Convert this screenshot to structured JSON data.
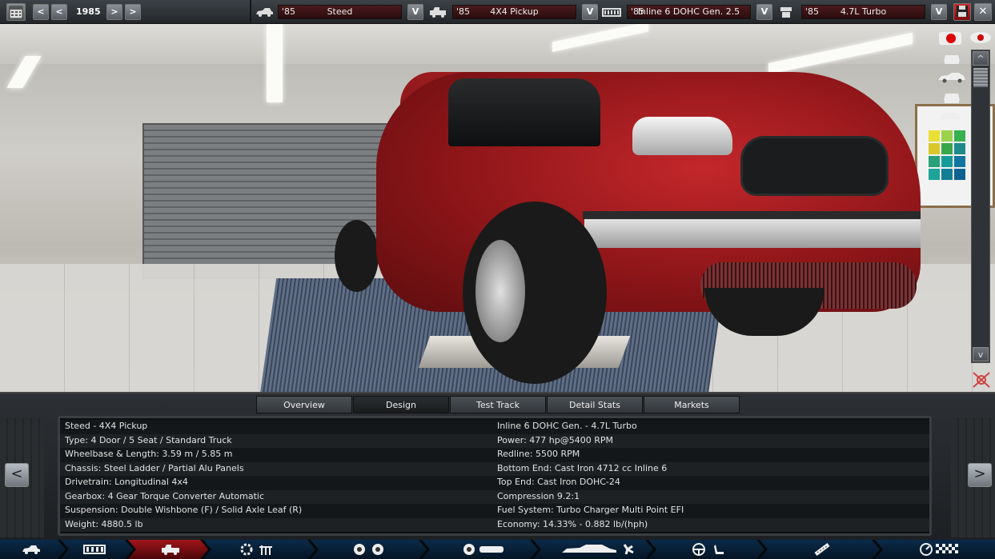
{
  "topbar": {
    "year": "1985",
    "car_model": {
      "year": "'85",
      "name": "Steed"
    },
    "trim": {
      "year": "'85",
      "name": "4X4 Pickup"
    },
    "engine_family": {
      "year": "'85",
      "name": "Inline 6 DOHC Gen. 2.5"
    },
    "engine_variant": {
      "year": "'85",
      "name": "4.7L Turbo"
    },
    "dropdown_glyph": "V",
    "prev_label": "<",
    "next_label": ">",
    "close_label": "✕"
  },
  "tabs": [
    "Overview",
    "Design",
    "Test Track",
    "Detail Stats",
    "Markets"
  ],
  "active_tab": "Design",
  "details": {
    "left": [
      "Steed - 4X4 Pickup",
      "Type: 4 Door / 5 Seat / Standard Truck",
      "Wheelbase & Length: 3.59 m / 5.85 m",
      "Chassis: Steel Ladder / Partial Alu Panels",
      "Drivetrain: Longitudinal 4x4",
      "Gearbox: 4 Gear Torque Converter Automatic",
      "Suspension: Double Wishbone (F) / Solid Axle Leaf (R)",
      "Weight: 4880.5 lb"
    ],
    "right": [
      "Inline 6 DOHC Gen.  - 4.7L Turbo",
      "Power: 477 hp@5400 RPM",
      "Redline: 5500 RPM",
      "Bottom End: Cast Iron 4712 cc Inline 6",
      "Top End: Cast Iron DOHC-24",
      "Compression 9.2:1",
      "Fuel System: Turbo Charger Multi Point EFI",
      "Economy: 14.33% - 0.882 lb/(hph)"
    ]
  },
  "panel_nav": {
    "prev": "<",
    "next": ">"
  },
  "scroll": {
    "up": "^",
    "down": "v"
  },
  "footer_sections": [
    "car-model-icon",
    "trim-body-icon",
    "trim-icon-active",
    "engine-icon",
    "suspension-icon",
    "brakes-icon",
    "body-aero-icon",
    "interior-icon",
    "exhaust-icon",
    "test-track-icon"
  ],
  "colors": {
    "accent_red": "#a0151b",
    "selector_bg": "#3a1415",
    "footer_blue": "#0a2a48"
  }
}
